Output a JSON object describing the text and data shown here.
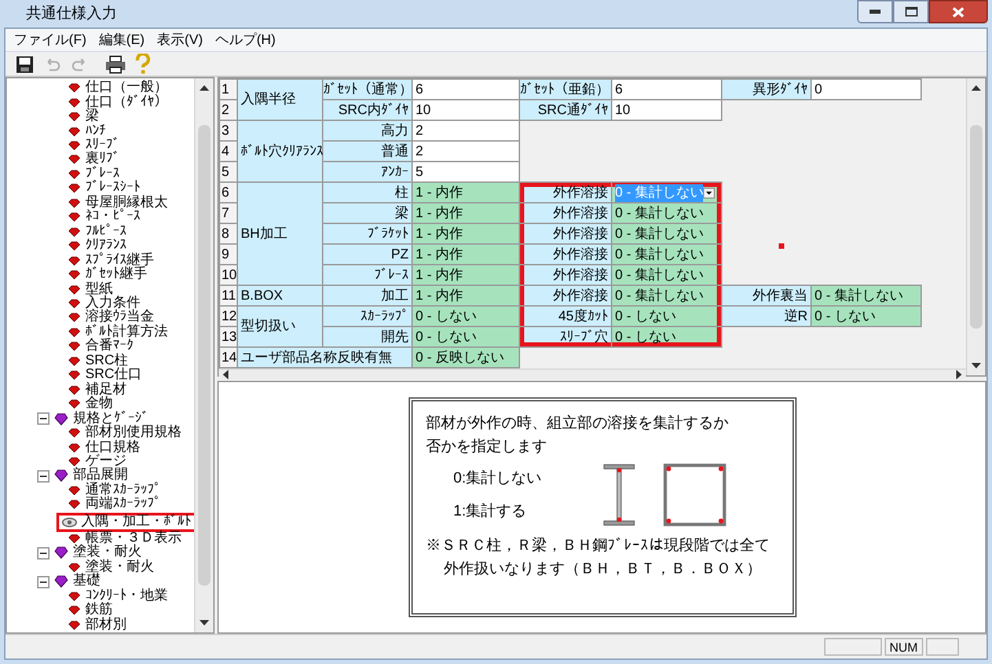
{
  "window": {
    "title": "共通仕様入力"
  },
  "menu": [
    "ファイル(F)",
    "編集(E)",
    "表示(V)",
    "ヘルプ(H)"
  ],
  "toolbar": [
    {
      "kind": "save",
      "disabled": false
    },
    {
      "kind": "undo",
      "disabled": true
    },
    {
      "kind": "redo",
      "disabled": true
    },
    {
      "kind": "print",
      "disabled": false
    },
    {
      "kind": "help",
      "disabled": false
    }
  ],
  "tree": [
    {
      "children": [
        {
          "label": "仕口（一般）",
          "selected": false
        },
        {
          "label": "仕口（ﾀﾞｲﾔ）",
          "selected": false
        },
        {
          "label": "梁",
          "selected": false
        },
        {
          "label": "ﾊﾝﾁ",
          "selected": false
        },
        {
          "label": "ｽﾘｰﾌﾞ",
          "selected": false
        },
        {
          "label": "裏ﾘﾌﾞ",
          "selected": false
        },
        {
          "label": "ﾌﾞﾚｰｽ",
          "selected": false
        },
        {
          "label": "ﾌﾞﾚｰｽｼｰﾄ",
          "selected": false
        },
        {
          "label": "母屋胴縁根太",
          "selected": false
        },
        {
          "label": "ﾈｺ・ﾋﾟｰｽ",
          "selected": false
        },
        {
          "label": "ﾌﾙﾋﾟｰｽ",
          "selected": false
        },
        {
          "label": "ｸﾘｱﾗﾝｽ",
          "selected": false
        },
        {
          "label": "ｽﾌﾟﾗｲｽ継手",
          "selected": false
        },
        {
          "label": "ｶﾞｾｯﾄ継手",
          "selected": false
        },
        {
          "label": "型紙",
          "selected": false
        },
        {
          "label": "入力条件",
          "selected": false
        },
        {
          "label": "溶接ｳﾗ当金",
          "selected": false
        },
        {
          "label": "ﾎﾞﾙﾄ計算方法",
          "selected": false
        },
        {
          "label": "合番ﾏｰｸ",
          "selected": false
        },
        {
          "label": "SRC柱",
          "selected": false
        },
        {
          "label": "SRC仕口",
          "selected": false
        },
        {
          "label": "補足材",
          "selected": false
        },
        {
          "label": "金物",
          "selected": false
        }
      ]
    },
    {
      "label": "規格とｹﾞｰｼﾞ",
      "expanded": true,
      "children": [
        {
          "label": "部材別使用規格",
          "selected": false
        },
        {
          "label": "仕口規格",
          "selected": false
        },
        {
          "label": "ゲージ",
          "selected": false
        }
      ]
    },
    {
      "label": "部品展開",
      "expanded": true,
      "children": [
        {
          "label": "通常ｽｶｰﾗｯﾌﾟ",
          "selected": false
        },
        {
          "label": "両端ｽｶｰﾗｯﾌﾟ",
          "selected": false
        },
        {
          "label": "入隅・加工・ﾎﾞﾙﾄ",
          "selected": true
        },
        {
          "label": "帳票・３Ｄ表示",
          "selected": false
        }
      ]
    },
    {
      "label": "塗装・耐火",
      "expanded": true,
      "children": [
        {
          "label": "塗装・耐火",
          "selected": false
        }
      ]
    },
    {
      "label": "基礎",
      "expanded": true,
      "children": [
        {
          "label": "ｺﾝｸﾘｰﾄ・地業",
          "selected": false
        },
        {
          "label": "鉄筋",
          "selected": false
        },
        {
          "label": "部材別",
          "selected": false
        }
      ]
    }
  ],
  "grid": {
    "groups": [
      {
        "label": "入隅半径",
        "rows": [
          {
            "no": "1",
            "cells": [
              {
                "label": "ｶﾞｾｯﾄ（通常）",
                "value": "6",
                "kind": "number",
                "selected": false,
                "highlighted": false
              },
              {
                "label": "ｶﾞｾｯﾄ（亜鉛）",
                "value": "6",
                "kind": "number",
                "selected": false,
                "highlighted": false
              },
              {
                "label": "異形ﾀﾞｲﾔ",
                "value": "0",
                "kind": "number",
                "selected": false,
                "highlighted": false
              }
            ]
          },
          {
            "no": "2",
            "cells": [
              {
                "label": "SRC内ﾀﾞｲﾔ",
                "value": "10",
                "kind": "number",
                "selected": false,
                "highlighted": false
              },
              {
                "label": "SRC通ﾀﾞｲﾔ",
                "value": "10",
                "kind": "number",
                "selected": false,
                "highlighted": false
              }
            ]
          }
        ]
      },
      {
        "label": "ﾎﾞﾙﾄ穴ｸﾘｱﾗﾝｽ",
        "rows": [
          {
            "no": "3",
            "cells": [
              {
                "label": "高力",
                "value": "2",
                "kind": "number",
                "selected": false,
                "highlighted": false
              }
            ]
          },
          {
            "no": "4",
            "cells": [
              {
                "label": "普通",
                "value": "2",
                "kind": "number",
                "selected": false,
                "highlighted": false
              }
            ]
          },
          {
            "no": "5",
            "cells": [
              {
                "label": "ｱﾝｶｰ",
                "value": "5",
                "kind": "number",
                "selected": false,
                "highlighted": false
              }
            ]
          }
        ]
      },
      {
        "label": "BH加工",
        "rows": [
          {
            "no": "6",
            "cells": [
              {
                "label": "柱",
                "value": "1 - 内作",
                "kind": "choice",
                "selected": false,
                "highlighted": false
              },
              {
                "label": "外作溶接",
                "value": "0 - 集計しない",
                "kind": "choice",
                "selected": true,
                "highlighted": true
              }
            ]
          },
          {
            "no": "7",
            "cells": [
              {
                "label": "梁",
                "value": "1 - 内作",
                "kind": "choice",
                "selected": false,
                "highlighted": false
              },
              {
                "label": "外作溶接",
                "value": "0 - 集計しない",
                "kind": "choice",
                "selected": false,
                "highlighted": true
              }
            ]
          },
          {
            "no": "8",
            "cells": [
              {
                "label": "ﾌﾞﾗｹｯﾄ",
                "value": "1 - 内作",
                "kind": "choice",
                "selected": false,
                "highlighted": false
              },
              {
                "label": "外作溶接",
                "value": "0 - 集計しない",
                "kind": "choice",
                "selected": false,
                "highlighted": true
              }
            ]
          },
          {
            "no": "9",
            "cells": [
              {
                "label": "PZ",
                "value": "1 - 内作",
                "kind": "choice",
                "selected": false,
                "highlighted": false
              },
              {
                "label": "外作溶接",
                "value": "0 - 集計しない",
                "kind": "choice",
                "selected": false,
                "highlighted": true
              }
            ]
          },
          {
            "no": "10",
            "cells": [
              {
                "label": "ﾌﾞﾚｰｽ",
                "value": "1 - 内作",
                "kind": "choice",
                "selected": false,
                "highlighted": false
              },
              {
                "label": "外作溶接",
                "value": "0 - 集計しない",
                "kind": "choice",
                "selected": false,
                "highlighted": true
              }
            ]
          }
        ]
      },
      {
        "label": "B.BOX",
        "rows": [
          {
            "no": "11",
            "cells": [
              {
                "label": "加工",
                "value": "1 - 内作",
                "kind": "choice",
                "selected": false,
                "highlighted": false
              },
              {
                "label": "外作溶接",
                "value": "0 - 集計しない",
                "kind": "choice",
                "selected": false,
                "highlighted": true
              },
              {
                "label": "外作裏当",
                "value": "0 - 集計しない",
                "kind": "choice",
                "selected": false,
                "highlighted": false
              }
            ]
          }
        ]
      },
      {
        "label": "型切扱い",
        "rows": [
          {
            "no": "12",
            "cells": [
              {
                "label": "ｽｶｰﾗｯﾌﾟ",
                "value": "0 - しない",
                "kind": "choice",
                "selected": false,
                "highlighted": false
              },
              {
                "label": "45度ｶｯﾄ",
                "value": "0 - しない",
                "kind": "choice",
                "selected": false,
                "highlighted": true
              },
              {
                "label": "逆R",
                "value": "0 - しない",
                "kind": "choice",
                "selected": false,
                "highlighted": false
              }
            ]
          },
          {
            "no": "13",
            "cells": [
              {
                "label": "開先",
                "value": "0 - しない",
                "kind": "choice",
                "selected": false,
                "highlighted": false
              },
              {
                "label": "ｽﾘｰﾌﾞ穴",
                "value": "0 - しない",
                "kind": "choice",
                "selected": false,
                "highlighted": true
              }
            ]
          }
        ]
      },
      {
        "label": "ユーザ部品名称反映有無",
        "rows": [
          {
            "no": "14",
            "cells": [
              {
                "value": "0 - 反映しない",
                "kind": "choice",
                "selected": false,
                "highlighted": false
              }
            ]
          }
        ]
      }
    ]
  },
  "description": {
    "lines": [
      "部材が外作の時、組立部の溶接を集計するか",
      "否かを指定します"
    ],
    "options": [
      "0:集計しない",
      "1:集計する"
    ],
    "notes": [
      "※ＳＲＣ柱，Ｒ梁，ＢＨ鋼ﾌﾞﾚｰｽは現段階では全て",
      "外作扱いなります（ＢＨ，ＢＴ，Ｂ．ＢＯＸ）"
    ]
  },
  "status_bar": {
    "indicators": [
      "NUM"
    ]
  }
}
